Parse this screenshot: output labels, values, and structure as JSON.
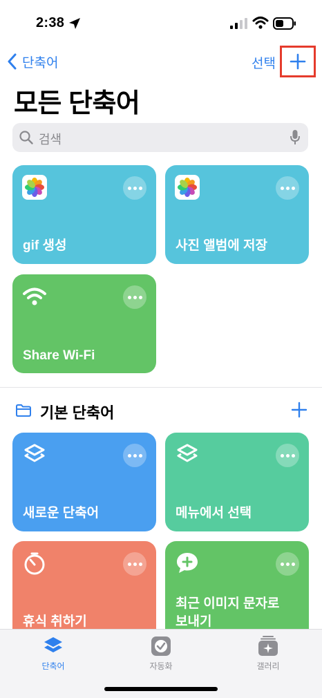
{
  "status_bar": {
    "time": "2:38"
  },
  "nav": {
    "back_label": "단축어",
    "select_label": "선택"
  },
  "page_title": "모든 단축어",
  "search": {
    "placeholder": "검색"
  },
  "shortcuts": [
    {
      "label": "gif 생성",
      "icon": "photos-icon",
      "color": "#56c4dc"
    },
    {
      "label": "사진 앨범에 저장",
      "icon": "photos-icon",
      "color": "#56c4dc"
    },
    {
      "label": "Share Wi-Fi",
      "icon": "wifi-icon",
      "color": "#63c466"
    }
  ],
  "folder": {
    "title": "기본 단축어",
    "shortcuts": [
      {
        "label": "새로운 단축어",
        "icon": "layers-icon",
        "color": "#4a9ff0"
      },
      {
        "label": "메뉴에서 선택",
        "icon": "layers-icon",
        "color": "#56cc9e"
      },
      {
        "label": "휴식 취하기",
        "icon": "timer-icon",
        "color": "#f0826a"
      },
      {
        "label": "최근 이미지 문자로\n보내기",
        "icon": "message-plus-icon",
        "color": "#63c466"
      }
    ]
  },
  "tabs": [
    {
      "label": "단축어",
      "icon": "layers-icon",
      "active": true
    },
    {
      "label": "자동화",
      "icon": "clock-check-icon",
      "active": false
    },
    {
      "label": "갤러리",
      "icon": "gallery-icon",
      "active": false
    }
  ],
  "colors": {
    "accent": "#2f80ed",
    "highlight": "#e53b2c"
  }
}
